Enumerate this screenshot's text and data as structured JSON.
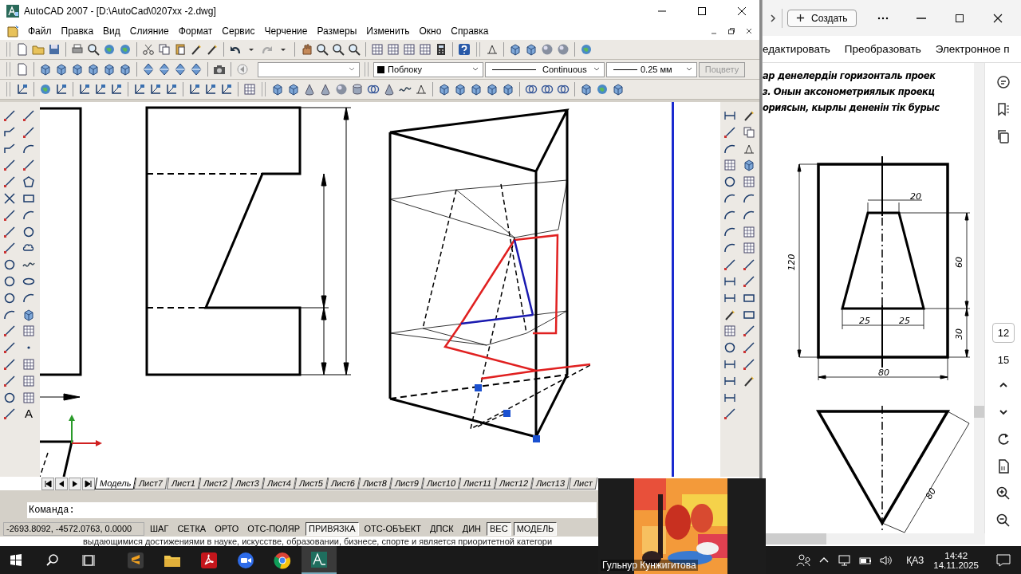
{
  "acad": {
    "title": "AutoCAD 2007 - [D:\\AutoCad\\0207xx -2.dwg]",
    "menu": [
      "Файл",
      "Правка",
      "Вид",
      "Слияние",
      "Формат",
      "Сервис",
      "Черчение",
      "Размеры",
      "Изменить",
      "Окно",
      "Справка"
    ],
    "properties": {
      "color_setting": "Поблоку",
      "linetype": "Continuous",
      "lineweight": "0.25 мм",
      "plot_style": {
        "label": "Поцвету",
        "disabled": true
      }
    },
    "text_tool": "A",
    "layout_tabs": [
      {
        "label": "Модель",
        "selected": true
      },
      {
        "label": "Лист7",
        "selected": false
      },
      {
        "label": "Лист1",
        "selected": false
      },
      {
        "label": "Лист2",
        "selected": false
      },
      {
        "label": "Лист3",
        "selected": false
      },
      {
        "label": "Лист4",
        "selected": false
      },
      {
        "label": "Лист5",
        "selected": false
      },
      {
        "label": "Лист6",
        "selected": false
      },
      {
        "label": "Лист8",
        "selected": false
      },
      {
        "label": "Лист9",
        "selected": false
      },
      {
        "label": "Лист10",
        "selected": false
      },
      {
        "label": "Лист11",
        "selected": false
      },
      {
        "label": "Лист12",
        "selected": false
      },
      {
        "label": "Лист13",
        "selected": false
      },
      {
        "label": "Лист",
        "selected": false
      }
    ],
    "command_prompt": "Команда:",
    "coordinates": "-2693.8092, -4572.0763, 0.0000",
    "status_buttons": [
      {
        "label": "ШАГ",
        "on": false
      },
      {
        "label": "СЕТКА",
        "on": false
      },
      {
        "label": "ОРТО",
        "on": false
      },
      {
        "label": "ОТС-ПОЛЯР",
        "on": false
      },
      {
        "label": "ПРИВЯЗКА",
        "on": true
      },
      {
        "label": "ОТС-ОБЪЕКТ",
        "on": false
      },
      {
        "label": "ДПСК",
        "on": false
      },
      {
        "label": "ДИН",
        "on": false
      },
      {
        "label": "ВЕС",
        "on": true
      },
      {
        "label": "МОДЕЛЬ",
        "on": true
      }
    ]
  },
  "background_text": "выдающимися достижениями в науке, искусстве, образовании, бизнесе, спорте и является приоритетной категори",
  "pdf": {
    "new_button": "Создать",
    "menu": [
      "едактировать",
      "Преобразовать",
      "Электронное п"
    ],
    "text_lines": [
      "ар денелердін горизонталь проек",
      "з. Онын аксонометриялык  проекц",
      "ориясын, кырлы дененін тік бурыс"
    ],
    "dimension_labels": [
      "20",
      "60",
      "25",
      "25",
      "30",
      "120",
      "80",
      "80"
    ],
    "page_current": "12",
    "page_total": "15"
  },
  "video": {
    "name": "Гульнур Кунжигитова"
  },
  "taskbar": {
    "apps": [
      {
        "kind": "editor",
        "active": false
      },
      {
        "kind": "folder",
        "active": false
      },
      {
        "kind": "pdf",
        "active": false
      },
      {
        "kind": "zoom",
        "active": false
      },
      {
        "kind": "browser",
        "active": false
      },
      {
        "kind": "cad",
        "active": true
      }
    ],
    "language": "ҚАЗ",
    "time": "14:42",
    "date": "14.11.2025"
  }
}
